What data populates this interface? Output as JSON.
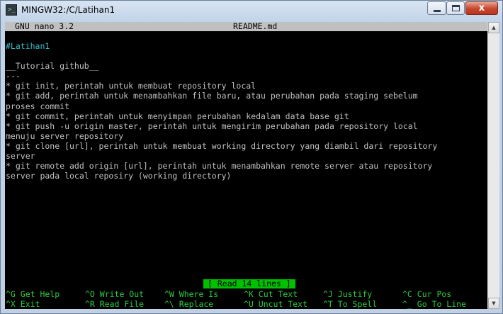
{
  "window": {
    "title": "MINGW32:/C/Latihan1",
    "icon": "terminal-icon",
    "close_label": "x"
  },
  "nano": {
    "version": "GNU nano 3.2",
    "filename": "README.md",
    "status": "[ Read 14 lines ]"
  },
  "editor": {
    "lines": [
      "#Latihan1",
      "",
      "__Tutorial github__",
      "---",
      "* git init, perintah untuk membuat repository local",
      "* git add, perintah untuk menambahkan file baru, atau perubahan pada staging sebelum",
      "proses commit",
      "* git commit, perintah untuk menyimpan perubahan kedalam data base git",
      "* git push -u origin master, perintah untuk mengirim perubahan pada repository local",
      "menuju server repository",
      "* git clone [url], perintah untuk membuat working directory yang diambil dari repository",
      "server",
      "* git remote add origin [url], perintah untuk menambahkan remote server atau repository",
      "server pada local reposiry (working directory)"
    ]
  },
  "shortcuts": {
    "row1": [
      "^G Get Help",
      "^O Write Out",
      "^W Where Is",
      "^K Cut Text",
      "^J Justify",
      "^C Cur Pos"
    ],
    "row2": [
      "^X Exit",
      "^R Read File",
      "^\\ Replace",
      "^U Uncut Text",
      "^T To Spell",
      "^_ Go To Line"
    ]
  },
  "colors": {
    "terminal_bg": "#000000",
    "text": "#c0c0c0",
    "heading": "#38bcc8",
    "shortcut_text": "#2ecc40",
    "status_bg": "#00c000"
  }
}
